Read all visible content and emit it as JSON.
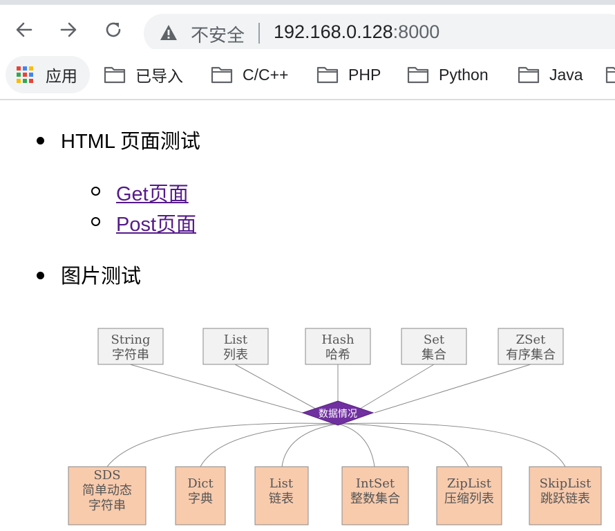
{
  "toolbar": {
    "back_icon": "arrow-left-icon",
    "forward_icon": "arrow-right-icon",
    "reload_icon": "reload-icon"
  },
  "address_bar": {
    "security_label": "不安全",
    "url_host": "192.168.0.128",
    "url_port": ":8000"
  },
  "bookmarks": {
    "apps": "应用",
    "items": [
      "已导入",
      "C/C++",
      "PHP",
      "Python",
      "Java"
    ]
  },
  "page": {
    "sections": [
      {
        "title": "HTML 页面测试",
        "links": [
          "Get页面",
          "Post页面"
        ]
      },
      {
        "title": "图片测试"
      }
    ]
  },
  "diagram": {
    "center_label": "数据情况",
    "center_color": "#7030a0",
    "top_boxes": [
      {
        "line1": "String",
        "line2": "字符串"
      },
      {
        "line1": "List",
        "line2": "列表"
      },
      {
        "line1": "Hash",
        "line2": "哈希"
      },
      {
        "line1": "Set",
        "line2": "集合"
      },
      {
        "line1": "ZSet",
        "line2": "有序集合"
      }
    ],
    "bottom_boxes": [
      {
        "line1": "SDS",
        "line2": "简单动态",
        "line3": "字符串"
      },
      {
        "line1": "Dict",
        "line2": "字典"
      },
      {
        "line1": "List",
        "line2": "链表"
      },
      {
        "line1": "IntSet",
        "line2": "整数集合"
      },
      {
        "line1": "ZipList",
        "line2": "压缩列表"
      },
      {
        "line1": "SkipList",
        "line2": "跳跃链表"
      }
    ],
    "top_box_color": "#f2f2f2",
    "bottom_box_color": "#f8cbad"
  }
}
